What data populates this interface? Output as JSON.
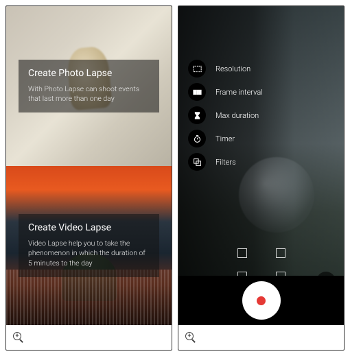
{
  "left": {
    "photo": {
      "title": "Create Photo Lapse",
      "desc": "With Photo Lapse can shoot events that last more than one day"
    },
    "video": {
      "title": "Create Video Lapse",
      "desc": "Video Lapse help you to take the phenomenon in which the duration of 5 minutes to the day"
    }
  },
  "right": {
    "settings": [
      {
        "key": "resolution",
        "label": "Resolution"
      },
      {
        "key": "frame_interval",
        "label": "Frame interval"
      },
      {
        "key": "max_duration",
        "label": "Max duration"
      },
      {
        "key": "timer",
        "label": "Timer"
      },
      {
        "key": "filters",
        "label": "Filters"
      }
    ]
  },
  "icons": {
    "zoom": "zoom-in-icon",
    "more": "more-icon",
    "record": "record-icon"
  }
}
